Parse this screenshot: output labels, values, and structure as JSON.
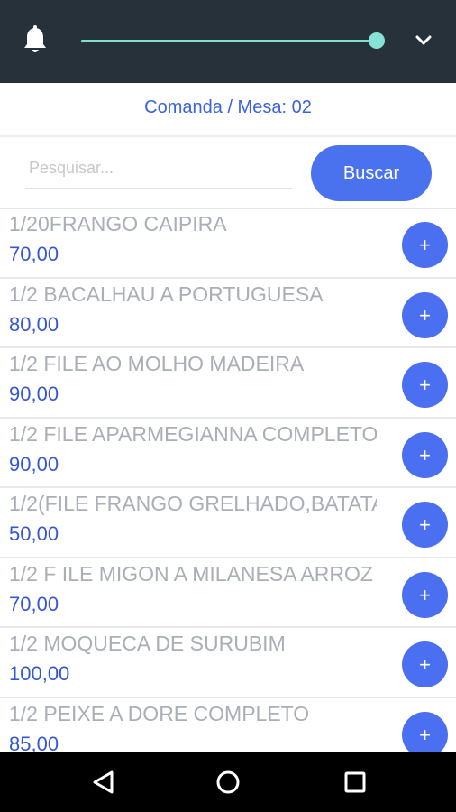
{
  "appbar": {
    "bell_icon": "bell-icon",
    "slider_level": 1.0,
    "chevron_icon": "chevron-down-icon"
  },
  "header": {
    "title": "Comanda / Mesa: 02"
  },
  "search": {
    "placeholder": "Pesquisar...",
    "value": "",
    "button_label": "Buscar"
  },
  "items": [
    {
      "name": "1/20FRANGO CAIPIRA",
      "price": "70,00",
      "add_label": "+"
    },
    {
      "name": "1/2 BACALHAU A PORTUGUESA",
      "price": "80,00",
      "add_label": "+"
    },
    {
      "name": "1/2 FILE AO MOLHO MADEIRA",
      "price": "90,00",
      "add_label": "+"
    },
    {
      "name": "1/2 FILE APARMEGIANNA COMPLETO",
      "price": "90,00",
      "add_label": "+"
    },
    {
      "name": "1/2(FILE  FRANGO GRELHADO,BATATA",
      "price": "50,00",
      "add_label": "+"
    },
    {
      "name": "1/2 F ILE MIGON A MILANESA ARROZ",
      "price": "70,00",
      "add_label": "+"
    },
    {
      "name": "1/2 MOQUECA DE SURUBIM",
      "price": "100,00",
      "add_label": "+"
    },
    {
      "name": "1/2 PEIXE A DORE COMPLETO",
      "price": "85,00",
      "add_label": "+"
    }
  ],
  "navbar": {
    "back_icon": "back-triangle-icon",
    "home_icon": "home-circle-icon",
    "recents_icon": "recents-square-icon"
  },
  "colors": {
    "appbar": "#27313a",
    "accent": "#4a72ef",
    "slider": "#7fe0d4",
    "price": "#3557d6",
    "item_name": "#a9aeb7"
  }
}
